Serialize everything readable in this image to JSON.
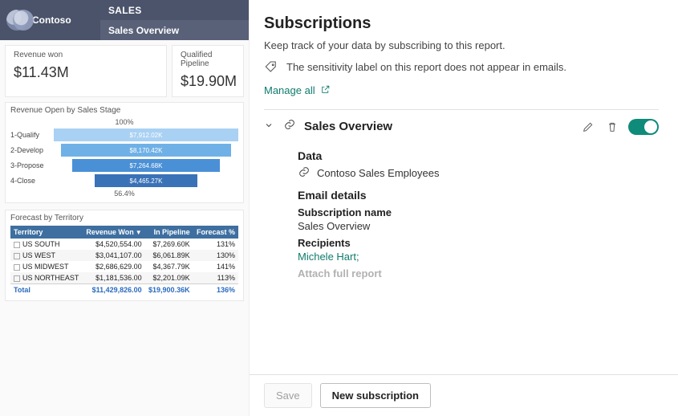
{
  "nav": {
    "brand": "Contoso",
    "tab_section": "SALES",
    "tab_page": "Sales Overview"
  },
  "cards": {
    "revenue_won": {
      "label": "Revenue won",
      "value": "$11.43M"
    },
    "qualified_pipeline": {
      "label": "Qualified Pipeline",
      "value": "$19.90M"
    }
  },
  "stage_panel": {
    "title": "Revenue Open by Sales Stage",
    "top_pct": "100%",
    "bottom_pct": "56.4%",
    "rows": [
      {
        "label": "1-Qualify",
        "value": "$7,912.02K",
        "width": "100%",
        "color": "#a9d1f3"
      },
      {
        "label": "2-Develop",
        "value": "$8,170.42K",
        "width": "92%",
        "color": "#6fb1e6"
      },
      {
        "label": "3-Propose",
        "value": "$7,264.68K",
        "width": "80%",
        "color": "#4a90d6"
      },
      {
        "label": "4-Close",
        "value": "$4,465.27K",
        "width": "56%",
        "color": "#3a72b7"
      }
    ]
  },
  "territory_panel": {
    "title": "Forecast by Territory",
    "cols": [
      "Territory",
      "Revenue Won",
      "In Pipeline",
      "Forecast %"
    ],
    "rows": [
      {
        "t": "US SOUTH",
        "won": "$4,520,554.00",
        "pipe": "$7,269.60K",
        "pct": "131%"
      },
      {
        "t": "US WEST",
        "won": "$3,041,107.00",
        "pipe": "$6,061.89K",
        "pct": "130%"
      },
      {
        "t": "US MIDWEST",
        "won": "$2,686,629.00",
        "pipe": "$4,367.79K",
        "pct": "141%"
      },
      {
        "t": "US NORTHEAST",
        "won": "$1,181,536.00",
        "pipe": "$2,201.09K",
        "pct": "113%"
      }
    ],
    "total": {
      "t": "Total",
      "won": "$11,429,826.00",
      "pipe": "$19,900.36K",
      "pct": "136%"
    }
  },
  "panel": {
    "title": "Subscriptions",
    "desc": "Keep track of your data by subscribing to this report.",
    "sensitivity": "The sensitivity label on this report does not appear in emails.",
    "manage_all": "Manage all"
  },
  "sub": {
    "name": "Sales Overview",
    "section_data": "Data",
    "data_value": "Contoso Sales Employees",
    "section_email": "Email details",
    "name_label": "Subscription name",
    "name_value": "Sales Overview",
    "recipients_label": "Recipients",
    "recipients_value": "Michele Hart;",
    "attach_label": "Attach full report"
  },
  "footer": {
    "save": "Save",
    "new": "New subscription"
  },
  "chart_data": {
    "type": "bar",
    "title": "Revenue Open by Sales Stage",
    "categories": [
      "1-Qualify",
      "2-Develop",
      "3-Propose",
      "4-Close"
    ],
    "values": [
      7912.02,
      8170.42,
      7264.68,
      4465.27
    ],
    "unit": "K USD",
    "funnel_top_pct": 100,
    "funnel_bottom_pct": 56.4
  }
}
